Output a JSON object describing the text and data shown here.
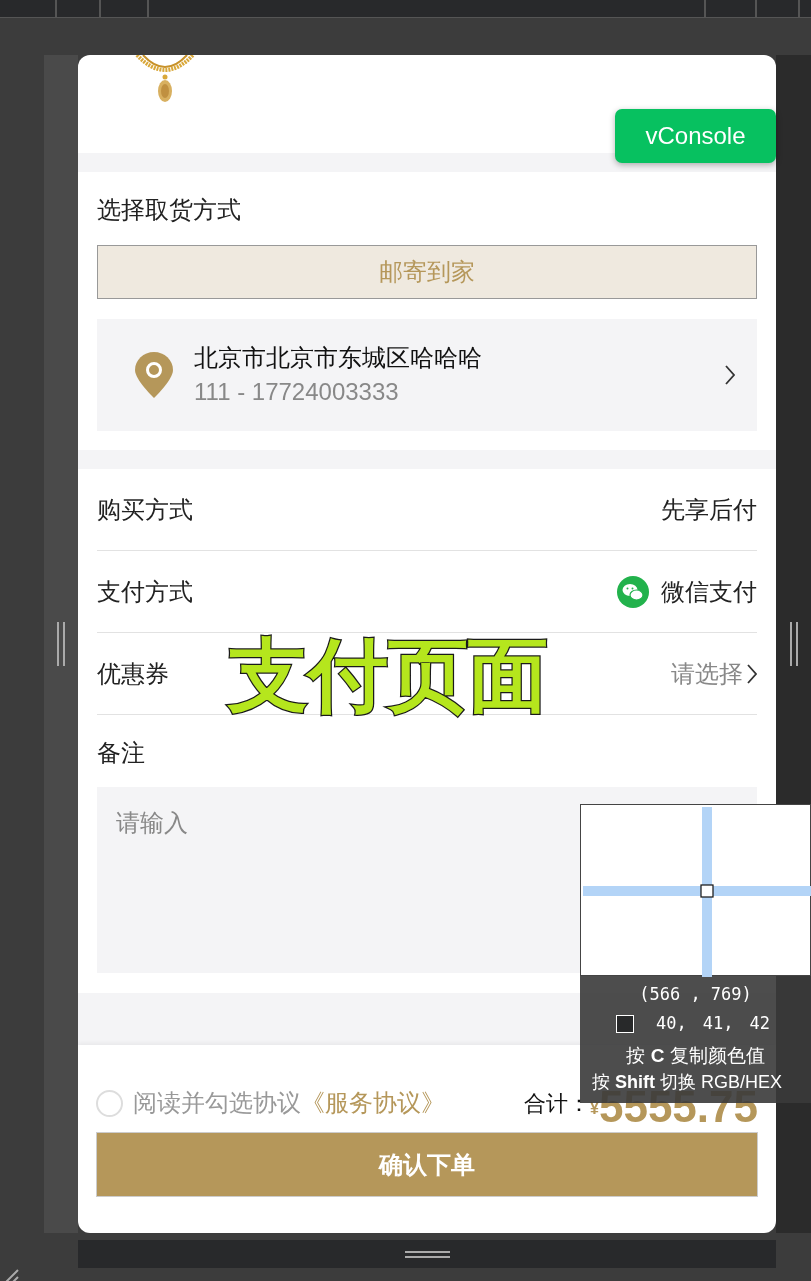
{
  "vconsole_button": "vConsole",
  "pickup": {
    "title": "选择取货方式",
    "options": [
      {
        "label": "邮寄到家",
        "selected": true
      }
    ]
  },
  "address": {
    "line": "北京市北京市东城区哈哈哈",
    "contact": "111 - 17724003333"
  },
  "order_rows": [
    {
      "label": "购买方式",
      "value": "先享后付",
      "kind": "text"
    },
    {
      "label": "支付方式",
      "value": "微信支付",
      "kind": "wechat"
    },
    {
      "label": "优惠券",
      "value": "请选择",
      "kind": "picker"
    }
  ],
  "remark": {
    "label": "备注",
    "placeholder": "请输入"
  },
  "agreement": {
    "checked": false,
    "text": "阅读并勾选协议",
    "link": "《服务协议》"
  },
  "total": {
    "label": "合计：",
    "currency": "¥",
    "amount": "5555.75"
  },
  "submit_button": "确认下单",
  "annotation": "支付页面",
  "color_picker": {
    "coords": "(566 , 769)",
    "rgb": [
      "40,",
      "41,",
      "42"
    ],
    "hint_copy": "按 **C** 复制颜色值",
    "hint_switch": "按 **Shift** 切换 RGB/HEX"
  }
}
